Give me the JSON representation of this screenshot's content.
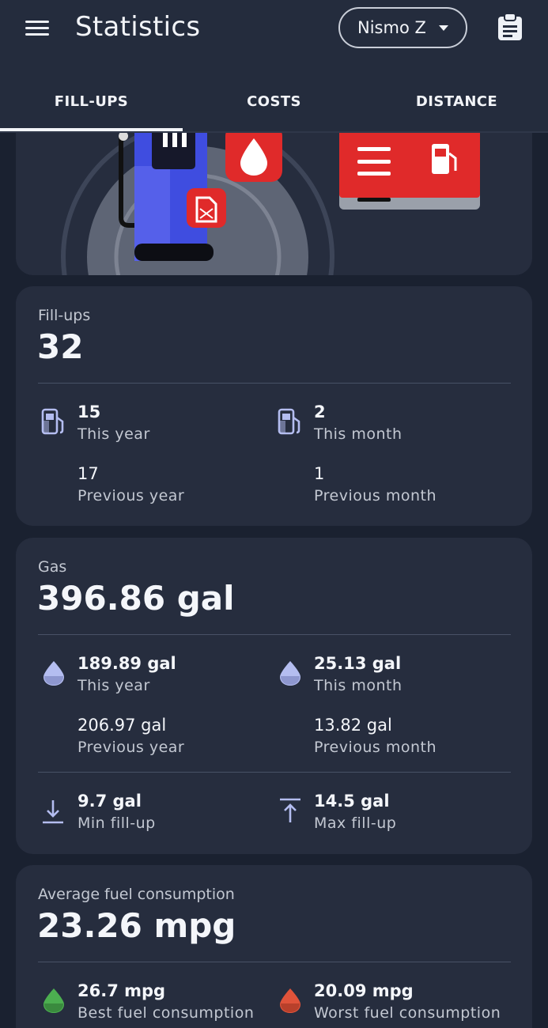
{
  "header": {
    "title": "Statistics",
    "vehicle": "Nismo Z"
  },
  "tabs": [
    {
      "label": "FILL-UPS",
      "active": true
    },
    {
      "label": "COSTS",
      "active": false
    },
    {
      "label": "DISTANCE",
      "active": false
    }
  ],
  "fillups": {
    "label": "Fill-ups",
    "total": "32",
    "this_year": {
      "value": "15",
      "label": "This year"
    },
    "previous_year": {
      "value": "17",
      "label": "Previous year"
    },
    "this_month": {
      "value": "2",
      "label": "This month"
    },
    "previous_month": {
      "value": "1",
      "label": "Previous month"
    }
  },
  "gas": {
    "label": "Gas",
    "total": "396.86 gal",
    "this_year": {
      "value": "189.89 gal",
      "label": "This year"
    },
    "previous_year": {
      "value": "206.97 gal",
      "label": "Previous year"
    },
    "this_month": {
      "value": "25.13 gal",
      "label": "This month"
    },
    "previous_month": {
      "value": "13.82 gal",
      "label": "Previous month"
    },
    "min_fillup": {
      "value": "9.7 gal",
      "label": "Min fill-up"
    },
    "max_fillup": {
      "value": "14.5 gal",
      "label": "Max fill-up"
    }
  },
  "consumption": {
    "label": "Average fuel consumption",
    "average": "23.26 mpg",
    "best": {
      "value": "26.7 mpg",
      "label": "Best fuel consumption"
    },
    "worst": {
      "value": "20.09 mpg",
      "label": "Worst fuel consumption"
    }
  },
  "colors": {
    "background": "#1a2130",
    "card": "#262d3e",
    "header": "#242c3d",
    "accent_icon": "#b4bdf0",
    "best": "#4caf50",
    "worst": "#e0533a",
    "illustration_red": "#e02a2a",
    "illustration_blue": "#3f4de0"
  }
}
